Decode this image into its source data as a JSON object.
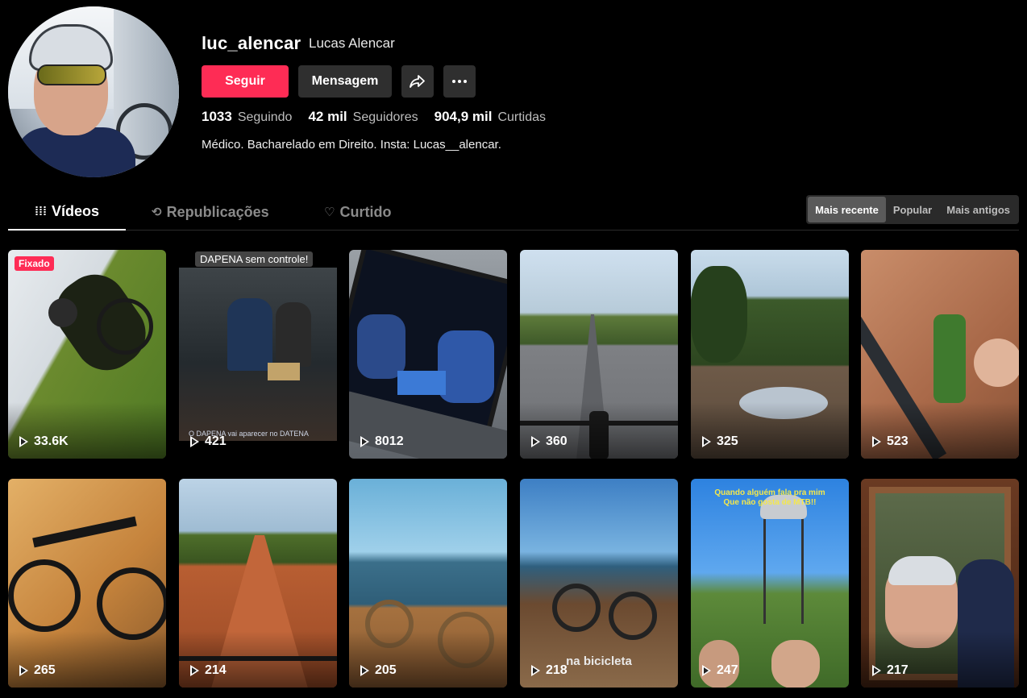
{
  "profile": {
    "username": "luc_alencar",
    "display_name": "Lucas Alencar",
    "follow_label": "Seguir",
    "message_label": "Mensagem",
    "stats": [
      {
        "value": "1033",
        "label": "Seguindo"
      },
      {
        "value": "42 mil",
        "label": "Seguidores"
      },
      {
        "value": "904,9 mil",
        "label": "Curtidas"
      }
    ],
    "bio": "Médico. Bacharelado em Direito. Insta: Lucas__alencar."
  },
  "tabs": {
    "videos": "Vídeos",
    "reposts": "Republicações",
    "liked": "Curtido"
  },
  "sort": {
    "recent": "Mais recente",
    "popular": "Popular",
    "oldest": "Mais antigos"
  },
  "videos": [
    {
      "views": "33.6K",
      "badge": "Fixado",
      "scene": "cyclist-leaning"
    },
    {
      "views": "421",
      "caption": "DAPENA sem controle!",
      "subcaption": "O DAPENA vai aparecer no DATENA",
      "scene": "tv-debate"
    },
    {
      "views": "8012",
      "scene": "laptop-debate"
    },
    {
      "views": "360",
      "scene": "road-handlebar"
    },
    {
      "views": "325",
      "scene": "trail-puddle"
    },
    {
      "views": "523",
      "scene": "bottle-bike"
    },
    {
      "views": "265",
      "scene": "bike-wall"
    },
    {
      "views": "214",
      "scene": "dirt-road"
    },
    {
      "views": "205",
      "scene": "lake-bike"
    },
    {
      "views": "218",
      "overlay": "na bicicleta",
      "scene": "bridge-bike"
    },
    {
      "views": "247",
      "overlay": "Quando alguém fala pra mim\nQue não gosta de MTB!!",
      "scene": "water-tower"
    },
    {
      "views": "217",
      "scene": "selfie-suit"
    }
  ],
  "colors": {
    "accent": "#fe2c55",
    "background": "#000000",
    "button_dark": "#2f2f2f"
  }
}
